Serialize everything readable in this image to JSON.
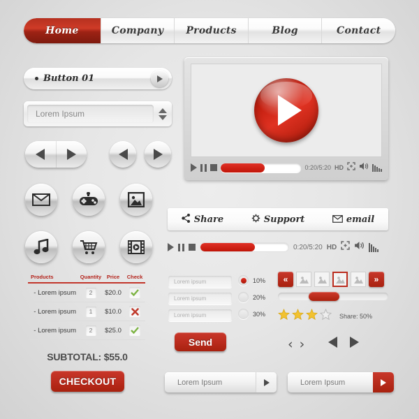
{
  "nav": {
    "items": [
      {
        "label": "Home",
        "active": true
      },
      {
        "label": "Company",
        "active": false
      },
      {
        "label": "Products",
        "active": false
      },
      {
        "label": "Blog",
        "active": false
      },
      {
        "label": "Contact",
        "active": false
      }
    ]
  },
  "button01": {
    "label": "Button 01",
    "arrow_icon": "play-arrow-icon"
  },
  "spinner": {
    "value": "Lorem Ipsum",
    "up_icon": "triangle-up-icon",
    "down_icon": "triangle-down-icon"
  },
  "icon_buttons": [
    {
      "name": "prev-icon"
    },
    {
      "name": "next-icon"
    },
    {
      "name": "prev-icon"
    },
    {
      "name": "next-icon"
    },
    {
      "name": "envelope-icon"
    },
    {
      "name": "gamepad-icon"
    },
    {
      "name": "image-icon"
    },
    {
      "name": "music-note-icon"
    },
    {
      "name": "shopping-cart-icon"
    },
    {
      "name": "film-video-icon"
    }
  ],
  "products_table": {
    "headers": [
      "Products",
      "Quantity",
      "Price",
      "Check"
    ],
    "rows": [
      {
        "name": "- Lorem ipsum",
        "qty": "2",
        "price": "$20.0",
        "check": "yes"
      },
      {
        "name": "- Lorem ipsum",
        "qty": "1",
        "price": "$10.0",
        "check": "no"
      },
      {
        "name": "- Lorem ipsum",
        "qty": "2",
        "price": "$25.0",
        "check": "yes"
      }
    ],
    "subtotal": "SUBTOTAL: $55.0",
    "checkout_label": "CHECKOUT"
  },
  "player": {
    "play_icon": "big-play-button-icon",
    "controls": {
      "play": "play-icon",
      "pause": "pause-icon",
      "stop": "stop-icon",
      "progress_percent": 55,
      "time": "0:20/5:20",
      "hd": "HD",
      "fullscreen_icon": "fullscreen-icon",
      "volume_icon": "speaker-icon",
      "equalizer_icon": "equalizer-icon"
    }
  },
  "share_bar": [
    {
      "label": "Share",
      "icon": "share-icon"
    },
    {
      "label": "Support",
      "icon": "gear-icon"
    },
    {
      "label": "email",
      "icon": "envelope-icon"
    }
  ],
  "control_bar_2": {
    "progress_percent": 62,
    "time": "0:20/5:20",
    "hd": "HD"
  },
  "form": {
    "inputs": [
      "Lorem ipsum",
      "Lorem ipsum",
      "Lorem ipsum"
    ],
    "radios": [
      {
        "label": "10%",
        "selected": true
      },
      {
        "label": "20%",
        "selected": false
      },
      {
        "label": "30%",
        "selected": false
      }
    ],
    "send_label": "Send"
  },
  "carousel": {
    "prev_label": "«",
    "next_label": "»",
    "thumbnails": [
      {
        "selected": false
      },
      {
        "selected": false
      },
      {
        "selected": true
      },
      {
        "selected": false
      }
    ],
    "slider_percent": 28
  },
  "rating": {
    "filled": 3,
    "total": 4,
    "share_label": "Share: 50%"
  },
  "pagers": {
    "chevron_left": "‹",
    "chevron_right": "›",
    "tri_left_icon": "triangle-left-icon",
    "tri_right_icon": "triangle-right-icon"
  },
  "search_bars": [
    {
      "value": "Lorem Ipsum",
      "button_style": "gray",
      "icon": "play-arrow-icon"
    },
    {
      "value": "Lorem Ipsum",
      "button_style": "red",
      "icon": "play-arrow-icon"
    }
  ],
  "colors": {
    "accent_red": "#bb2c1e",
    "dark_red": "#a8210f",
    "check_green": "#7cb342",
    "star_yellow": "#f2c230",
    "background": "#e6e6e6"
  }
}
